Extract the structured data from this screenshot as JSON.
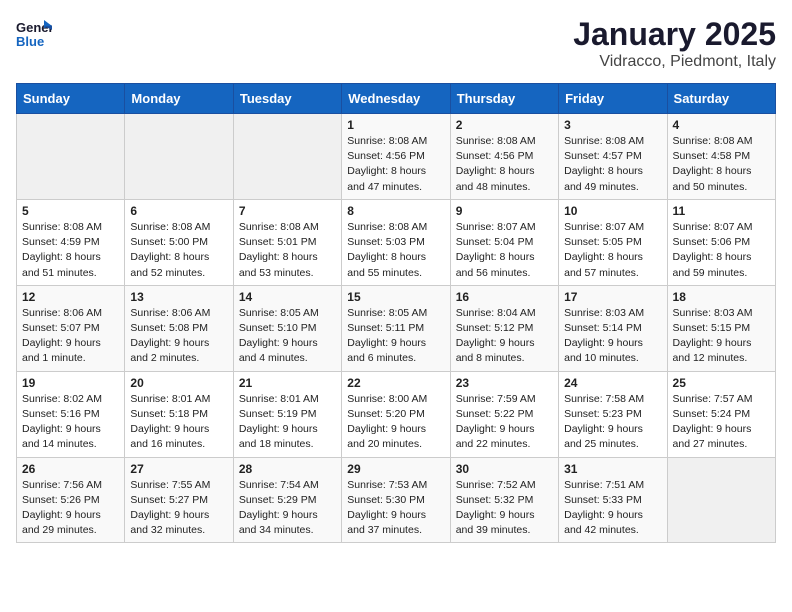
{
  "logo": {
    "line1": "General",
    "line2": "Blue"
  },
  "title": "January 2025",
  "subtitle": "Vidracco, Piedmont, Italy",
  "weekdays": [
    "Sunday",
    "Monday",
    "Tuesday",
    "Wednesday",
    "Thursday",
    "Friday",
    "Saturday"
  ],
  "weeks": [
    [
      {
        "day": "",
        "info": ""
      },
      {
        "day": "",
        "info": ""
      },
      {
        "day": "",
        "info": ""
      },
      {
        "day": "1",
        "info": "Sunrise: 8:08 AM\nSunset: 4:56 PM\nDaylight: 8 hours\nand 47 minutes."
      },
      {
        "day": "2",
        "info": "Sunrise: 8:08 AM\nSunset: 4:56 PM\nDaylight: 8 hours\nand 48 minutes."
      },
      {
        "day": "3",
        "info": "Sunrise: 8:08 AM\nSunset: 4:57 PM\nDaylight: 8 hours\nand 49 minutes."
      },
      {
        "day": "4",
        "info": "Sunrise: 8:08 AM\nSunset: 4:58 PM\nDaylight: 8 hours\nand 50 minutes."
      }
    ],
    [
      {
        "day": "5",
        "info": "Sunrise: 8:08 AM\nSunset: 4:59 PM\nDaylight: 8 hours\nand 51 minutes."
      },
      {
        "day": "6",
        "info": "Sunrise: 8:08 AM\nSunset: 5:00 PM\nDaylight: 8 hours\nand 52 minutes."
      },
      {
        "day": "7",
        "info": "Sunrise: 8:08 AM\nSunset: 5:01 PM\nDaylight: 8 hours\nand 53 minutes."
      },
      {
        "day": "8",
        "info": "Sunrise: 8:08 AM\nSunset: 5:03 PM\nDaylight: 8 hours\nand 55 minutes."
      },
      {
        "day": "9",
        "info": "Sunrise: 8:07 AM\nSunset: 5:04 PM\nDaylight: 8 hours\nand 56 minutes."
      },
      {
        "day": "10",
        "info": "Sunrise: 8:07 AM\nSunset: 5:05 PM\nDaylight: 8 hours\nand 57 minutes."
      },
      {
        "day": "11",
        "info": "Sunrise: 8:07 AM\nSunset: 5:06 PM\nDaylight: 8 hours\nand 59 minutes."
      }
    ],
    [
      {
        "day": "12",
        "info": "Sunrise: 8:06 AM\nSunset: 5:07 PM\nDaylight: 9 hours\nand 1 minute."
      },
      {
        "day": "13",
        "info": "Sunrise: 8:06 AM\nSunset: 5:08 PM\nDaylight: 9 hours\nand 2 minutes."
      },
      {
        "day": "14",
        "info": "Sunrise: 8:05 AM\nSunset: 5:10 PM\nDaylight: 9 hours\nand 4 minutes."
      },
      {
        "day": "15",
        "info": "Sunrise: 8:05 AM\nSunset: 5:11 PM\nDaylight: 9 hours\nand 6 minutes."
      },
      {
        "day": "16",
        "info": "Sunrise: 8:04 AM\nSunset: 5:12 PM\nDaylight: 9 hours\nand 8 minutes."
      },
      {
        "day": "17",
        "info": "Sunrise: 8:03 AM\nSunset: 5:14 PM\nDaylight: 9 hours\nand 10 minutes."
      },
      {
        "day": "18",
        "info": "Sunrise: 8:03 AM\nSunset: 5:15 PM\nDaylight: 9 hours\nand 12 minutes."
      }
    ],
    [
      {
        "day": "19",
        "info": "Sunrise: 8:02 AM\nSunset: 5:16 PM\nDaylight: 9 hours\nand 14 minutes."
      },
      {
        "day": "20",
        "info": "Sunrise: 8:01 AM\nSunset: 5:18 PM\nDaylight: 9 hours\nand 16 minutes."
      },
      {
        "day": "21",
        "info": "Sunrise: 8:01 AM\nSunset: 5:19 PM\nDaylight: 9 hours\nand 18 minutes."
      },
      {
        "day": "22",
        "info": "Sunrise: 8:00 AM\nSunset: 5:20 PM\nDaylight: 9 hours\nand 20 minutes."
      },
      {
        "day": "23",
        "info": "Sunrise: 7:59 AM\nSunset: 5:22 PM\nDaylight: 9 hours\nand 22 minutes."
      },
      {
        "day": "24",
        "info": "Sunrise: 7:58 AM\nSunset: 5:23 PM\nDaylight: 9 hours\nand 25 minutes."
      },
      {
        "day": "25",
        "info": "Sunrise: 7:57 AM\nSunset: 5:24 PM\nDaylight: 9 hours\nand 27 minutes."
      }
    ],
    [
      {
        "day": "26",
        "info": "Sunrise: 7:56 AM\nSunset: 5:26 PM\nDaylight: 9 hours\nand 29 minutes."
      },
      {
        "day": "27",
        "info": "Sunrise: 7:55 AM\nSunset: 5:27 PM\nDaylight: 9 hours\nand 32 minutes."
      },
      {
        "day": "28",
        "info": "Sunrise: 7:54 AM\nSunset: 5:29 PM\nDaylight: 9 hours\nand 34 minutes."
      },
      {
        "day": "29",
        "info": "Sunrise: 7:53 AM\nSunset: 5:30 PM\nDaylight: 9 hours\nand 37 minutes."
      },
      {
        "day": "30",
        "info": "Sunrise: 7:52 AM\nSunset: 5:32 PM\nDaylight: 9 hours\nand 39 minutes."
      },
      {
        "day": "31",
        "info": "Sunrise: 7:51 AM\nSunset: 5:33 PM\nDaylight: 9 hours\nand 42 minutes."
      },
      {
        "day": "",
        "info": ""
      }
    ]
  ]
}
